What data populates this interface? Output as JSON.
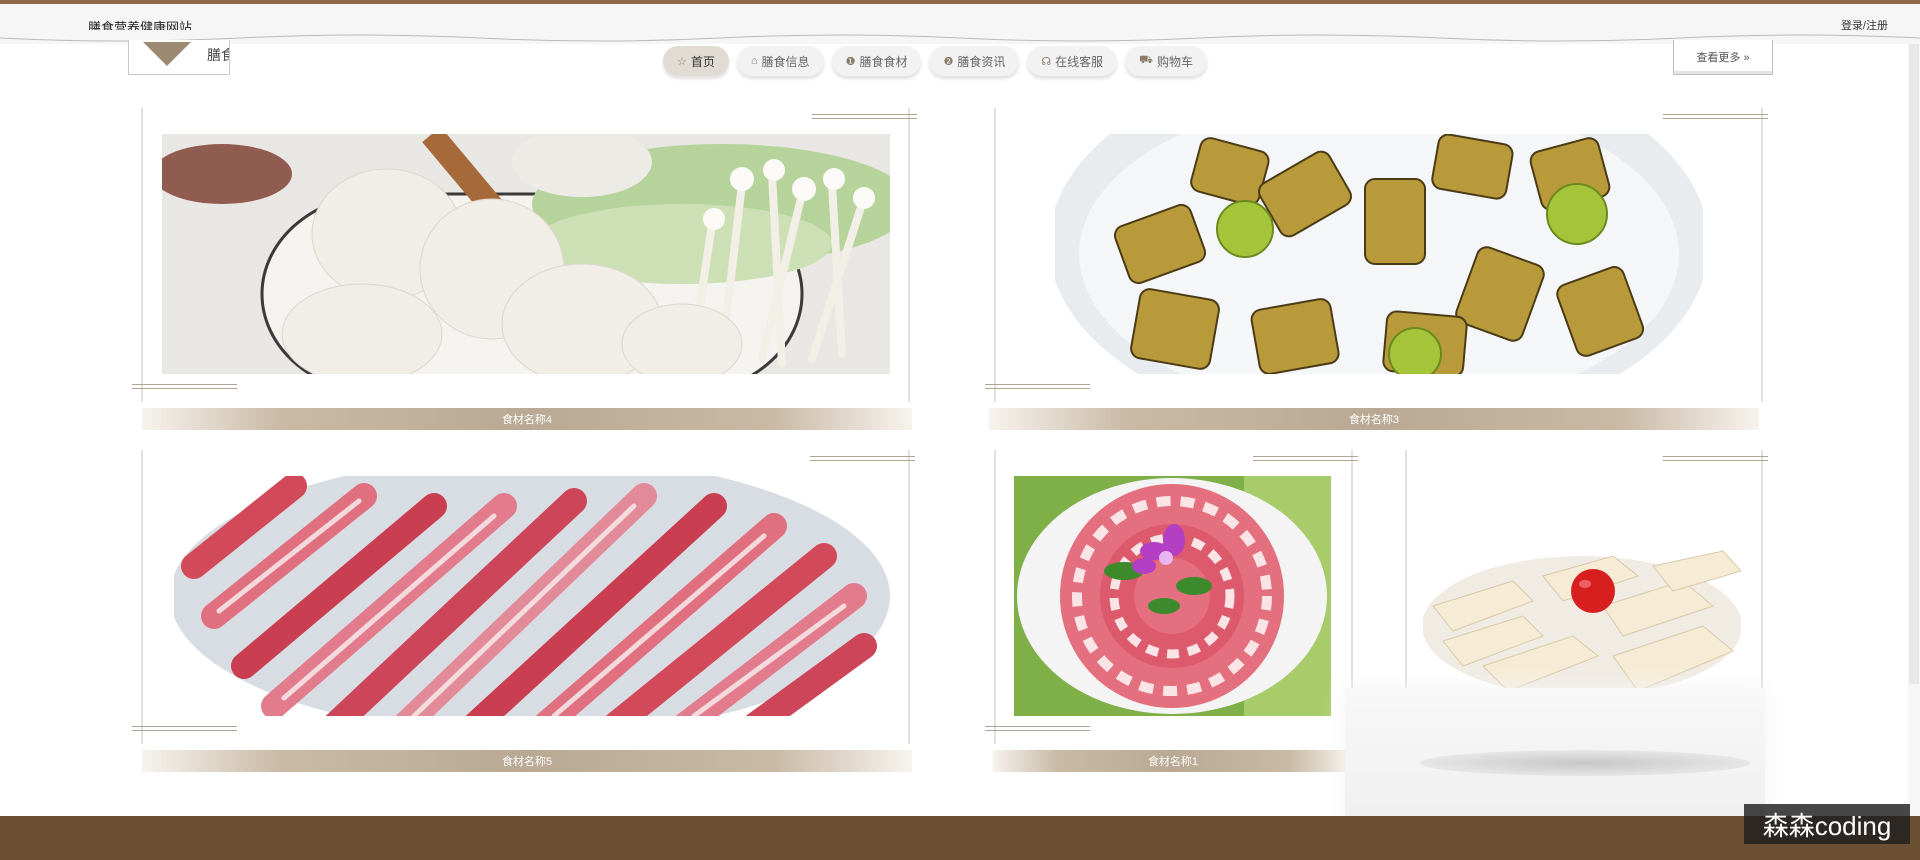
{
  "header": {
    "site_title": "膳食营养健康网站",
    "login_register": "登录/注册",
    "logo_text": "膳食"
  },
  "nav": {
    "items": [
      {
        "label": "首页",
        "icon": "star-icon",
        "glyph": "☆"
      },
      {
        "label": "膳食信息",
        "icon": "home-icon",
        "glyph": "⌂"
      },
      {
        "label": "膳食食材",
        "icon": "info-icon",
        "glyph": "❶"
      },
      {
        "label": "膳食资讯",
        "icon": "question-icon",
        "glyph": "❷"
      },
      {
        "label": "在线客服",
        "icon": "headset-icon",
        "glyph": "☊"
      },
      {
        "label": "购物车",
        "icon": "cart-icon",
        "glyph": "⛟"
      }
    ],
    "active_index": 0
  },
  "more_button": "查看更多 »",
  "cards": [
    {
      "caption": "食材名称4",
      "image": "fishballs-mushrooms"
    },
    {
      "caption": "食材名称3",
      "image": "eel-on-ice"
    },
    {
      "caption": "食材名称5",
      "image": "sliced-pork"
    },
    {
      "caption": "食材名称1",
      "image": "lamb-rolls"
    },
    {
      "caption": "",
      "image": "tofu-slices"
    }
  ],
  "footer": {
    "color": "#6b5034"
  },
  "watermark": "森森coding"
}
